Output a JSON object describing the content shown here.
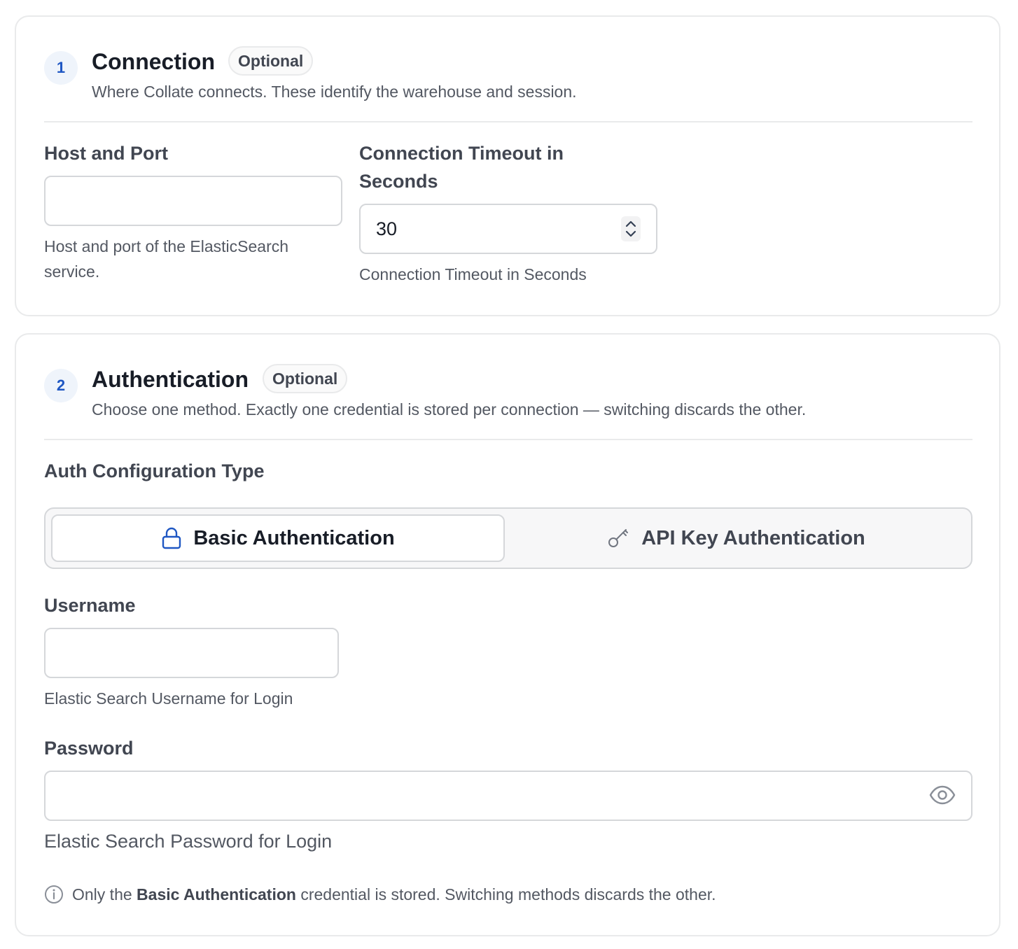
{
  "connection": {
    "step": "1",
    "title": "Connection",
    "badge": "Optional",
    "subtitle": "Where Collate connects. These identify the warehouse and session.",
    "host_port": {
      "label": "Host and Port",
      "value": "",
      "placeholder": "",
      "hint_line1": "Host and port of the ElasticSearch",
      "hint_line2": "service."
    },
    "timeout": {
      "label_line1": "Connection Timeout in",
      "label_line2": "Seconds",
      "value": "30",
      "hint": "Connection Timeout in Seconds"
    }
  },
  "authentication": {
    "step": "2",
    "title": "Authentication",
    "badge": "Optional",
    "subtitle": "Choose one method. Exactly one credential is stored per connection — switching discards the other.",
    "config_type_label": "Auth Configuration Type",
    "options": [
      {
        "label": "Basic Authentication",
        "icon": "lock-icon",
        "selected": true
      },
      {
        "label": "API Key Authentication",
        "icon": "key-icon",
        "selected": false
      }
    ],
    "username": {
      "label": "Username",
      "value": "",
      "hint": "Elastic Search Username for Login"
    },
    "password": {
      "label": "Password",
      "value": "",
      "hint": "Elastic Search Password for Login"
    },
    "info": {
      "prefix": "Only the",
      "strong": "Basic Authentication",
      "suffix": "credential is stored. Switching methods discards the other."
    }
  },
  "colors": {
    "accent": "#1f57c3",
    "step_bg": "#eff4fb",
    "border": "#d5d7da"
  }
}
